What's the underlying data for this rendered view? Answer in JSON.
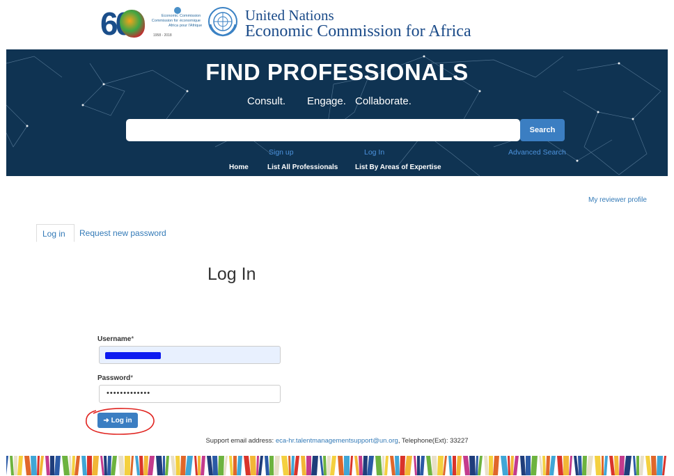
{
  "header": {
    "anniversary_logo": {
      "number": "60",
      "text_en": "Economic Commission for Africa",
      "text_fr": "Commission économique pour l'Afrique",
      "years": "1958 - 2018"
    },
    "un_line1": "United Nations",
    "un_line2": "Economic Commission for Africa"
  },
  "banner": {
    "title": "FIND PROFESSIONALS",
    "tagline": [
      "Consult.",
      "Engage.",
      "Collaborate."
    ],
    "search_placeholder": "",
    "search_button": "Search",
    "links": {
      "signup": "Sign up",
      "login": "Log In",
      "advanced": "Advanced Search"
    },
    "nav": [
      "Home",
      "List All Professionals",
      "List By Areas of Expertise"
    ],
    "colors": {
      "background": "#0f3352",
      "button": "#3b7ec2",
      "link": "#4d93dd"
    }
  },
  "main": {
    "reviewer_link": "My reviewer profile",
    "tabs": [
      {
        "label": "Log in",
        "active": true
      },
      {
        "label": "Request new password",
        "active": false
      }
    ],
    "heading": "Log In",
    "username_label": "Username",
    "password_label": "Password",
    "required_marker": "*",
    "password_mask": "•••••••••••••",
    "login_button": "Log in"
  },
  "footer": {
    "support_prefix": "Support email address:",
    "support_email": "eca-hr.talentmanagementsupport@un.org",
    "support_suffix": ", Telephone(Ext): 33227"
  }
}
